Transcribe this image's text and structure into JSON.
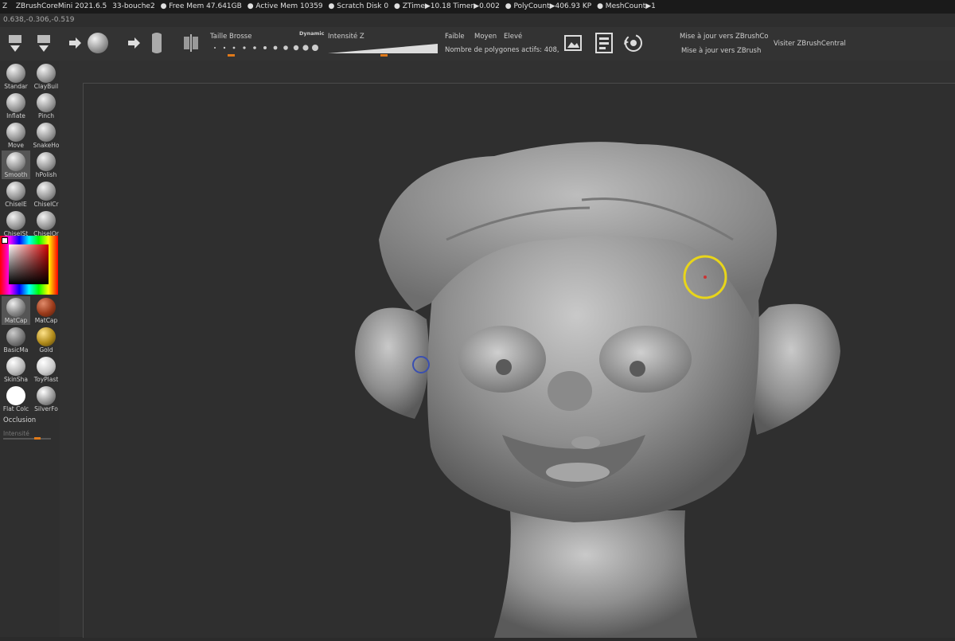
{
  "titlebar": {
    "app": "ZBrushCoreMini 2021.6.5",
    "doc": "33-bouche2",
    "free_mem": "● Free Mem 47.641GB",
    "active_mem": "● Active Mem 10359",
    "scratch": "● Scratch Disk 0",
    "ztime": "● ZTime▶10.18 Timer▶0.002",
    "polycount": "● PolyCount▶406.93 KP",
    "meshcount": "● MeshCount▶1"
  },
  "coords": "0.638,-0.306,-0.519",
  "toolbar": {
    "brush_size_label": "Taille Brosse",
    "dynamic_label": "Dynamic",
    "intensity_label": "Intensité Z",
    "weak": "Faible",
    "medium": "Moyen",
    "high": "Elevé",
    "active_polys": "Nombre de polygones actifs: 408,",
    "update_co": "Mise à jour vers ZBrushCo",
    "update_zb": "Mise à jour vers ZBrush",
    "visit_central": "Visiter ZBrushCentral"
  },
  "brushes": [
    {
      "label": "Standar",
      "icon": "standard-brush-icon"
    },
    {
      "label": "ClayBuil",
      "icon": "claybuildup-brush-icon"
    },
    {
      "label": "Inflate",
      "icon": "inflate-brush-icon"
    },
    {
      "label": "Pinch",
      "icon": "pinch-brush-icon"
    },
    {
      "label": "Move",
      "icon": "move-brush-icon"
    },
    {
      "label": "SnakeHo",
      "icon": "snakehook-brush-icon"
    },
    {
      "label": "Smooth",
      "icon": "smooth-brush-icon"
    },
    {
      "label": "hPolish",
      "icon": "hpolish-brush-icon"
    },
    {
      "label": "ChiselE",
      "icon": "chisel-ear-brush-icon"
    },
    {
      "label": "ChiselCr",
      "icon": "chisel-creature-brush-icon"
    },
    {
      "label": "ChiselSt",
      "icon": "chisel-st-brush-icon"
    },
    {
      "label": "ChiselOr",
      "icon": "chisel-or-brush-icon"
    }
  ],
  "materials": [
    {
      "label": "MatCap",
      "icon": "matcap-grey-icon"
    },
    {
      "label": "MatCap",
      "icon": "matcap-red-icon"
    },
    {
      "label": "BasicMa",
      "icon": "basic-material-icon"
    },
    {
      "label": "Gold",
      "icon": "gold-material-icon"
    },
    {
      "label": "SkinSha",
      "icon": "skin-shade-icon"
    },
    {
      "label": "ToyPlast",
      "icon": "toy-plastic-icon"
    },
    {
      "label": "Flat Colc",
      "icon": "flat-color-icon"
    },
    {
      "label": "SilverFo",
      "icon": "silver-foil-icon"
    }
  ],
  "occlusion_label": "Occlusion",
  "intensity_small_label": "Intensité",
  "colors": {
    "accent": "#e07a1a",
    "cursor": "#e8d51a",
    "background": "#2b2b2b"
  }
}
